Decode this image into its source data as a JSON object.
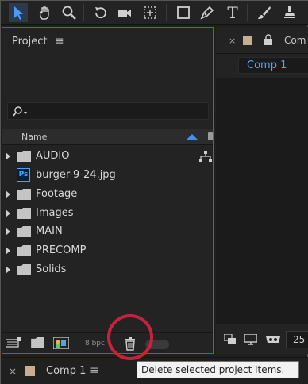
{
  "toolbar": {
    "tools": [
      {
        "icon": "selection-arrow-icon"
      },
      {
        "icon": "hand-icon"
      },
      {
        "icon": "zoom-icon"
      },
      {
        "icon": "rotate-icon"
      },
      {
        "icon": "camera-icon"
      },
      {
        "icon": "pan-behind-icon"
      },
      {
        "icon": "rectangle-icon"
      },
      {
        "icon": "pen-icon"
      },
      {
        "icon": "type-icon",
        "glyph": "T"
      },
      {
        "icon": "brush-icon"
      },
      {
        "icon": "stamp-icon"
      }
    ]
  },
  "project": {
    "title": "Project",
    "menu_glyph": "≡",
    "search": {
      "value": "",
      "placeholder": ""
    },
    "columns": {
      "name": "Name"
    },
    "items": [
      {
        "type": "folder",
        "label": "AUDIO",
        "expandable": true
      },
      {
        "type": "psd",
        "label": "burger-9-24.jpg",
        "badge": "Ps",
        "expandable": false
      },
      {
        "type": "folder",
        "label": "Footage",
        "expandable": true
      },
      {
        "type": "folder",
        "label": "Images",
        "expandable": true
      },
      {
        "type": "folder",
        "label": "MAIN",
        "expandable": true
      },
      {
        "type": "folder",
        "label": "PRECOMP",
        "expandable": true
      },
      {
        "type": "folder",
        "label": "Solids",
        "expandable": true
      }
    ],
    "bottom_bar": {
      "bit_depth": "8 bpc"
    }
  },
  "composition": {
    "close_glyph": "×",
    "header_label": "Com",
    "tab_label": "Comp 1",
    "zoom_value": "25"
  },
  "timeline": {
    "close_glyph": "×",
    "tab_label": "Comp 1",
    "menu_glyph": "≡"
  },
  "tooltip": {
    "text": "Delete selected project items."
  },
  "colors": {
    "accent": "#3f8ff5",
    "comp_label": "#c7ae8e",
    "highlight": "#c8213e",
    "panel_border": "#2e6dbd"
  }
}
